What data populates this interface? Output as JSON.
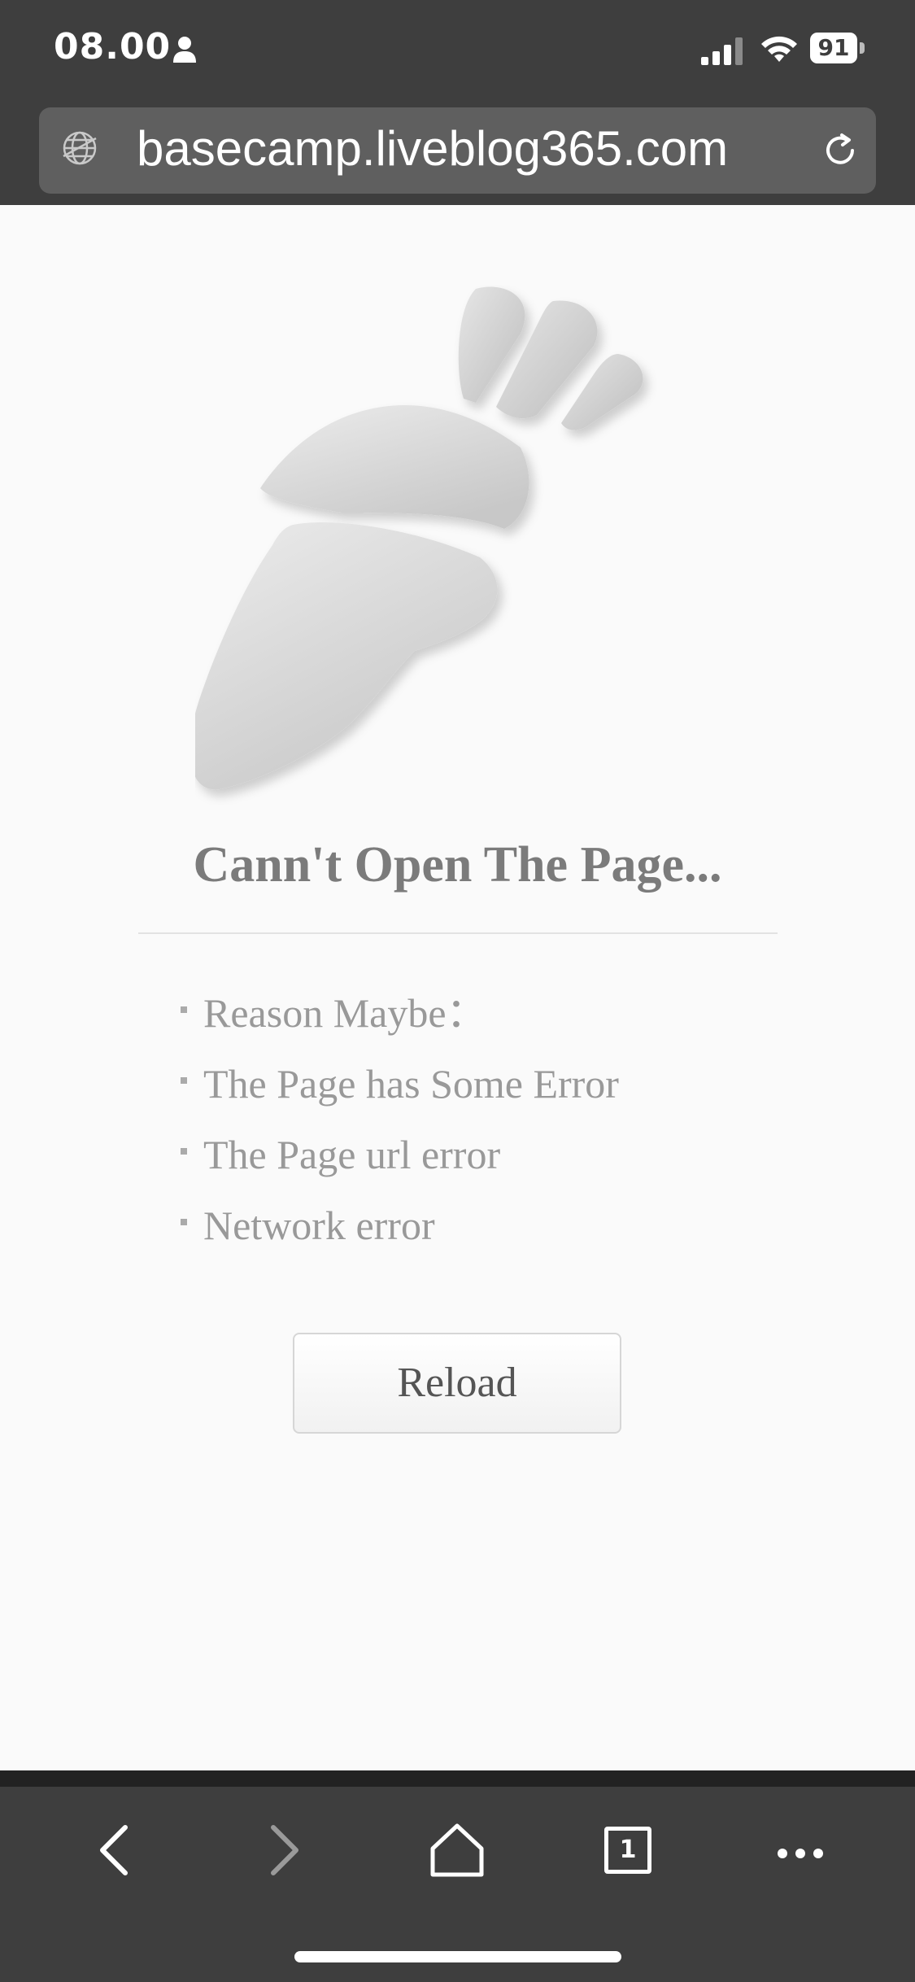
{
  "status_bar": {
    "time": "08.00",
    "battery_level": "91"
  },
  "url_bar": {
    "url": "basecamp.liveblog365.com"
  },
  "error_page": {
    "title": "Cann't Open The Page...",
    "reasons": [
      "Reason Maybe：",
      "The Page has Some Error",
      "The Page url error",
      "Network error"
    ],
    "reload_label": "Reload"
  },
  "toolbar": {
    "tab_count": "1",
    "icons": [
      "back-icon",
      "forward-icon",
      "home-icon",
      "tabs-icon",
      "more-icon"
    ]
  },
  "colors": {
    "chrome_bg": "#3e3e3e",
    "url_field_bg": "#5f5f5f",
    "page_bg": "#fafafa",
    "title_text": "#7b7b7b",
    "reason_text": "#999999"
  }
}
